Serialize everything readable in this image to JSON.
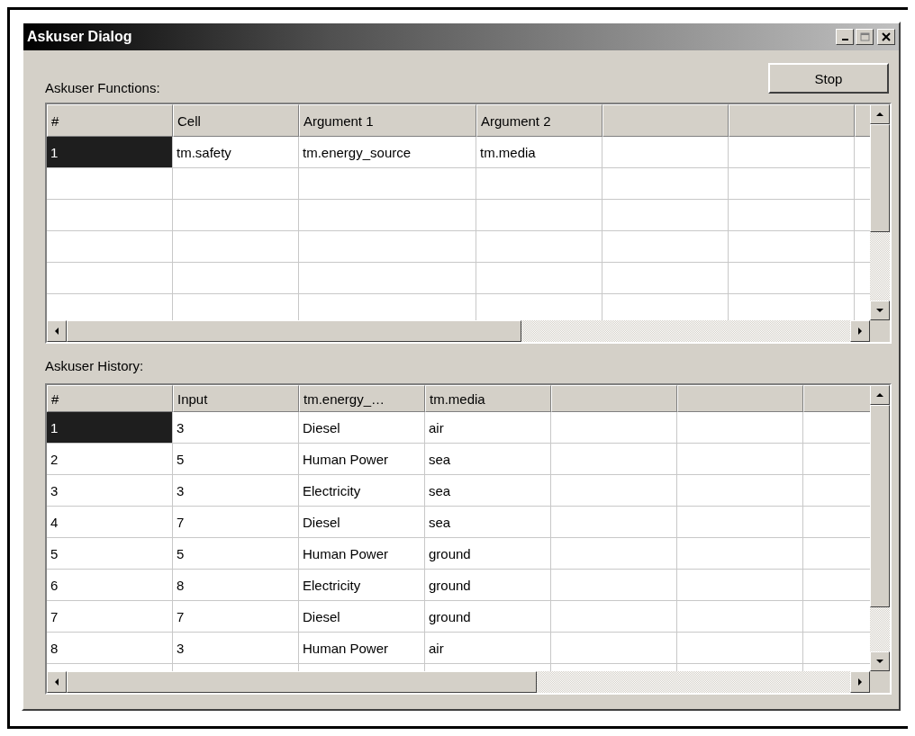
{
  "window": {
    "title": "Askuser Dialog"
  },
  "stop_button": "Stop",
  "functions": {
    "label": "Askuser Functions:",
    "columns": [
      "#",
      "Cell",
      "Argument 1",
      "Argument 2"
    ],
    "rows": [
      {
        "cells": [
          "1",
          "tm.safety",
          "tm.energy_source",
          "tm.media"
        ],
        "selected": true
      }
    ]
  },
  "history": {
    "label": "Askuser History:",
    "columns": [
      "#",
      "Input",
      "tm.energy_…",
      "tm.media"
    ],
    "rows": [
      {
        "cells": [
          "1",
          "3",
          "Diesel",
          "air"
        ],
        "selected": true
      },
      {
        "cells": [
          "2",
          "5",
          "Human Power",
          "sea"
        ],
        "selected": false
      },
      {
        "cells": [
          "3",
          "3",
          "Electricity",
          "sea"
        ],
        "selected": false
      },
      {
        "cells": [
          "4",
          "7",
          "Diesel",
          "sea"
        ],
        "selected": false
      },
      {
        "cells": [
          "5",
          "5",
          "Human Power",
          "ground"
        ],
        "selected": false
      },
      {
        "cells": [
          "6",
          "8",
          "Electricity",
          "ground"
        ],
        "selected": false
      },
      {
        "cells": [
          "7",
          "7",
          "Diesel",
          "ground"
        ],
        "selected": false
      },
      {
        "cells": [
          "8",
          "3",
          "Human Power",
          "air"
        ],
        "selected": false
      }
    ]
  }
}
